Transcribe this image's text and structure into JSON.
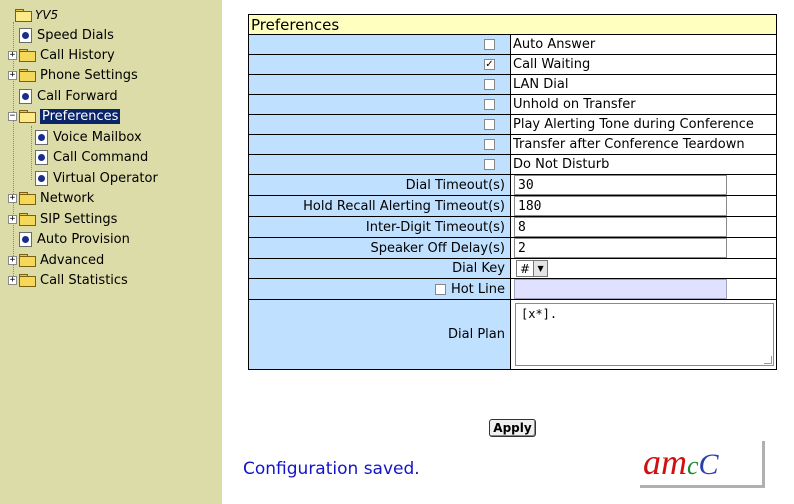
{
  "tree": {
    "root": "YV5",
    "items": [
      {
        "label": "Speed Dials"
      },
      {
        "label": "Call History"
      },
      {
        "label": "Phone Settings"
      },
      {
        "label": "Call Forward"
      },
      {
        "label": "Preferences"
      },
      {
        "label": "Voice Mailbox"
      },
      {
        "label": "Call Command"
      },
      {
        "label": "Virtual Operator"
      },
      {
        "label": "Network"
      },
      {
        "label": "SIP Settings"
      },
      {
        "label": "Auto Provision"
      },
      {
        "label": "Advanced"
      },
      {
        "label": "Call Statistics"
      }
    ],
    "selected": "Preferences",
    "expand_symbol": "+",
    "collapse_symbol": "−"
  },
  "prefs": {
    "title": "Preferences",
    "checkboxes": [
      {
        "label": "Auto Answer",
        "checked": false
      },
      {
        "label": "Call Waiting",
        "checked": true
      },
      {
        "label": "LAN Dial",
        "checked": false
      },
      {
        "label": "Unhold on Transfer",
        "checked": false
      },
      {
        "label": "Play Alerting Tone during Conference",
        "checked": false
      },
      {
        "label": "Transfer after Conference Teardown",
        "checked": false
      },
      {
        "label": "Do Not Disturb",
        "checked": false
      }
    ],
    "check_mark": "✓",
    "dial_timeout": {
      "label": "Dial Timeout(s)",
      "value": "30"
    },
    "hold_recall": {
      "label": "Hold Recall Alerting Timeout(s)",
      "value": "180"
    },
    "inter_digit": {
      "label": "Inter-Digit Timeout(s)",
      "value": "8"
    },
    "speaker_off": {
      "label": "Speaker Off Delay(s)",
      "value": "2"
    },
    "dial_key": {
      "label": "Dial Key",
      "value": "#",
      "arrow": "▼"
    },
    "hot_line": {
      "label": "Hot Line",
      "checked": false,
      "value": ""
    },
    "dial_plan": {
      "label": "Dial Plan",
      "value": "[x*]."
    }
  },
  "apply_label": "Apply",
  "status_message": "Configuration saved.",
  "logo": {
    "a": "a",
    "m": "m",
    "c1": "c",
    "c2": "C"
  },
  "colors": {
    "sidebar_bg": "#dcdca8",
    "label_cell": "#c0e0ff",
    "title_bar": "#ffffc0",
    "selected_bg": "#0a246a",
    "status_text": "#1414c8"
  }
}
